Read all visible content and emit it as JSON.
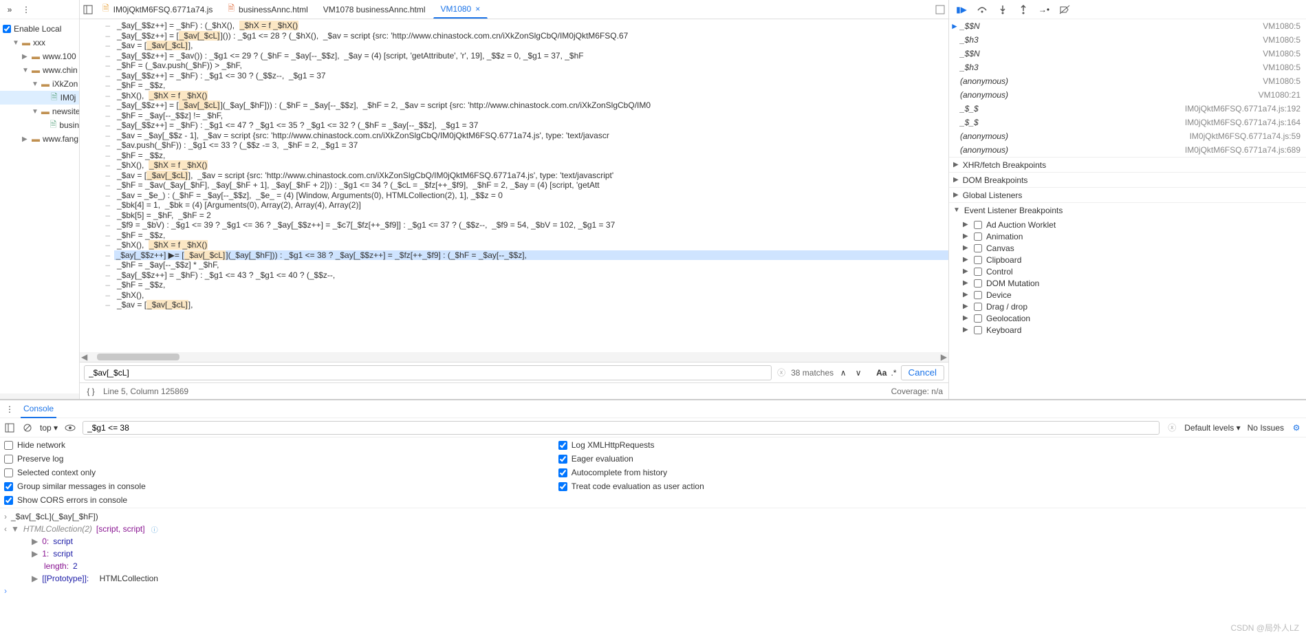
{
  "nav": {
    "enable_local": "Enable Local",
    "tree": [
      {
        "t": "xxx",
        "cls": "folder",
        "ind": "indent1",
        "tw": "▼"
      },
      {
        "t": "www.100",
        "cls": "folder",
        "ind": "indent2",
        "tw": "▶"
      },
      {
        "t": "www.chin",
        "cls": "folder",
        "ind": "indent2",
        "tw": "▼"
      },
      {
        "t": "iXkZon",
        "cls": "folder",
        "ind": "indent3",
        "tw": "▼"
      },
      {
        "t": "IM0j",
        "cls": "file",
        "ind": "indent4",
        "tw": "",
        "sel": true
      },
      {
        "t": "newsite",
        "cls": "folder",
        "ind": "indent3",
        "tw": "▼"
      },
      {
        "t": "busin",
        "cls": "file",
        "ind": "indent4",
        "tw": ""
      },
      {
        "t": "www.fang",
        "cls": "folder",
        "ind": "indent2",
        "tw": "▶"
      }
    ]
  },
  "tabs": [
    {
      "label": "IM0jQktM6FSQ.6771a74.js",
      "icon": "js"
    },
    {
      "label": "businessAnnc.html",
      "icon": "html"
    },
    {
      "label": "VM1078 businessAnnc.html",
      "icon": ""
    },
    {
      "label": "VM1080",
      "icon": "",
      "active": true,
      "close": true
    }
  ],
  "code": {
    "lines": [
      "_$ay[_$$z++] = _$hF) : (_$hX(),  _$hX = f _$hX()",
      "_$ay[_$$z++] = [_$av[_$cL]]()) : _$g1 <= 28 ? (_$hX(),  _$av = script {src: 'http://www.chinastock.com.cn/iXkZonSlgCbQ/IM0jQktM6FSQ.67",
      "_$av = [_$av[_$cL]],",
      "_$ay[_$$z++] = _$av()) : _$g1 <= 29 ? (_$hF = _$ay[--_$$z],  _$ay = (4) [script, 'getAttribute', 'r', 19], _$$z = 0, _$g1 = 37, _$hF",
      "_$hF = (_$av.push(_$hF)) > _$hF,",
      "_$ay[_$$z++] = _$hF) : _$g1 <= 30 ? (_$$z--,  _$g1 = 37",
      "_$hF = _$$z,",
      "_$hX(),  _$hX = f _$hX()",
      "_$ay[_$$z++] = [_$av[_$cL]](_$ay[_$hF])) : (_$hF = _$ay[--_$$z],  _$hF = 2, _$av = script {src: 'http://www.chinastock.com.cn/iXkZonSlgCbQ/IM0",
      "_$hF = _$ay[--_$$z] != _$hF,",
      "_$ay[_$$z++] = _$hF) : _$g1 <= 47 ? _$g1 <= 35 ? _$g1 <= 32 ? (_$hF = _$ay[--_$$z],  _$g1 = 37",
      "_$av = _$ay[_$$z - 1],  _$av = script {src: 'http://www.chinastock.com.cn/iXkZonSlgCbQ/IM0jQktM6FSQ.6771a74.js', type: 'text/javascr",
      "_$av.push(_$hF)) : _$g1 <= 33 ? (_$$z -= 3,  _$hF = 2, _$g1 = 37",
      "_$hF = _$$z,",
      "_$hX(),  _$hX = f _$hX()",
      "_$av = [_$av[_$cL]],  _$av = script {src: 'http://www.chinastock.com.cn/iXkZonSlgCbQ/IM0jQktM6FSQ.6771a74.js', type: 'text/javascript'",
      "_$hF = _$av(_$ay[_$hF], _$ay[_$hF + 1], _$ay[_$hF + 2])) : _$g1 <= 34 ? (_$cL = _$fz[++_$f9],  _$hF = 2, _$ay = (4) [script, 'getAtt",
      "_$av = _$e_) : (_$hF = _$ay[--_$$z],  _$e_ = (4) [Window, Arguments(0), HTMLCollection(2), 1], _$$z = 0",
      "_$bk[4] = 1,  _$bk = (4) [Arguments(0), Array(2), Array(4), Array(2)]",
      "_$bk[5] = _$hF,  _$hF = 2",
      "_$f9 = _$bV) : _$g1 <= 39 ? _$g1 <= 36 ? _$ay[_$$z++] = _$c7[_$fz[++_$f9]] : _$g1 <= 37 ? (_$$z--,  _$f9 = 54, _$bV = 102, _$g1 = 37",
      "_$hF = _$$z,",
      "_$hX(),  _$hX = f _$hX()",
      "_$ay[_$$z++] ▶= [_$av[_$cL]](_$ay[_$hF])) : _$g1 <= 38 ? _$ay[_$$z++] = _$fz[++_$f9] : (_$hF = _$ay[--_$$z],",
      "_$hF = _$ay[--_$$z] * _$hF,",
      "_$ay[_$$z++] = _$hF) : _$g1 <= 43 ? _$g1 <= 40 ? (_$$z--,",
      "_$hF = _$$z,",
      "_$hX(),",
      "_$av = [_$av[_$cL]],"
    ],
    "cur": 23
  },
  "search": {
    "value": "_$av[_$cL]",
    "matches": "38 matches",
    "aa": "Aa",
    "regex": ".*",
    "cancel": "Cancel"
  },
  "status": {
    "pos": "Line 5, Column 125869",
    "cov": "Coverage: n/a"
  },
  "callstack": [
    {
      "n": "_$$N",
      "l": "VM1080:5",
      "cur": true
    },
    {
      "n": "_$h3",
      "l": "VM1080:5"
    },
    {
      "n": "_$$N",
      "l": "VM1080:5"
    },
    {
      "n": "_$h3",
      "l": "VM1080:5"
    },
    {
      "n": "(anonymous)",
      "l": "VM1080:5"
    },
    {
      "n": "(anonymous)",
      "l": "VM1080:21"
    },
    {
      "n": "_$_$",
      "l": "IM0jQktM6FSQ.6771a74.js:192"
    },
    {
      "n": "_$_$",
      "l": "IM0jQktM6FSQ.6771a74.js:164"
    },
    {
      "n": "(anonymous)",
      "l": "IM0jQktM6FSQ.6771a74.js:59"
    },
    {
      "n": "(anonymous)",
      "l": "IM0jQktM6FSQ.6771a74.js:689"
    }
  ],
  "sections": [
    {
      "t": "XHR/fetch Breakpoints",
      "exp": false
    },
    {
      "t": "DOM Breakpoints",
      "exp": false
    },
    {
      "t": "Global Listeners",
      "exp": false
    },
    {
      "t": "Event Listener Breakpoints",
      "exp": true
    }
  ],
  "evbp": [
    "Ad Auction Worklet",
    "Animation",
    "Canvas",
    "Clipboard",
    "Control",
    "DOM Mutation",
    "Device",
    "Drag / drop",
    "Geolocation",
    "Keyboard"
  ],
  "console": {
    "tab": "Console",
    "top": "top",
    "filter_value": "_$g1 <= 38",
    "levels": "Default levels",
    "noissues": "No Issues",
    "settings_left": [
      {
        "l": "Hide network",
        "c": false
      },
      {
        "l": "Preserve log",
        "c": false
      },
      {
        "l": "Selected context only",
        "c": false
      },
      {
        "l": "Group similar messages in console",
        "c": true
      },
      {
        "l": "Show CORS errors in console",
        "c": true
      }
    ],
    "settings_right": [
      {
        "l": "Log XMLHttpRequests",
        "c": true
      },
      {
        "l": "Eager evaluation",
        "c": true
      },
      {
        "l": "Autocomplete from history",
        "c": true
      },
      {
        "l": "Treat code evaluation as user action",
        "c": true
      }
    ],
    "body": {
      "in": "_$av[_$cL](_$ay[_$hF])",
      "out_head": "HTMLCollection(2)",
      "out_arr": " [script, script]",
      "items": [
        {
          "k": "0:",
          "v": "script"
        },
        {
          "k": "1:",
          "v": "script"
        },
        {
          "k": "length:",
          "v": "2"
        }
      ],
      "proto_k": "[[Prototype]]:",
      "proto_v": "HTMLCollection"
    }
  },
  "watermark": "CSDN @局外人LZ"
}
